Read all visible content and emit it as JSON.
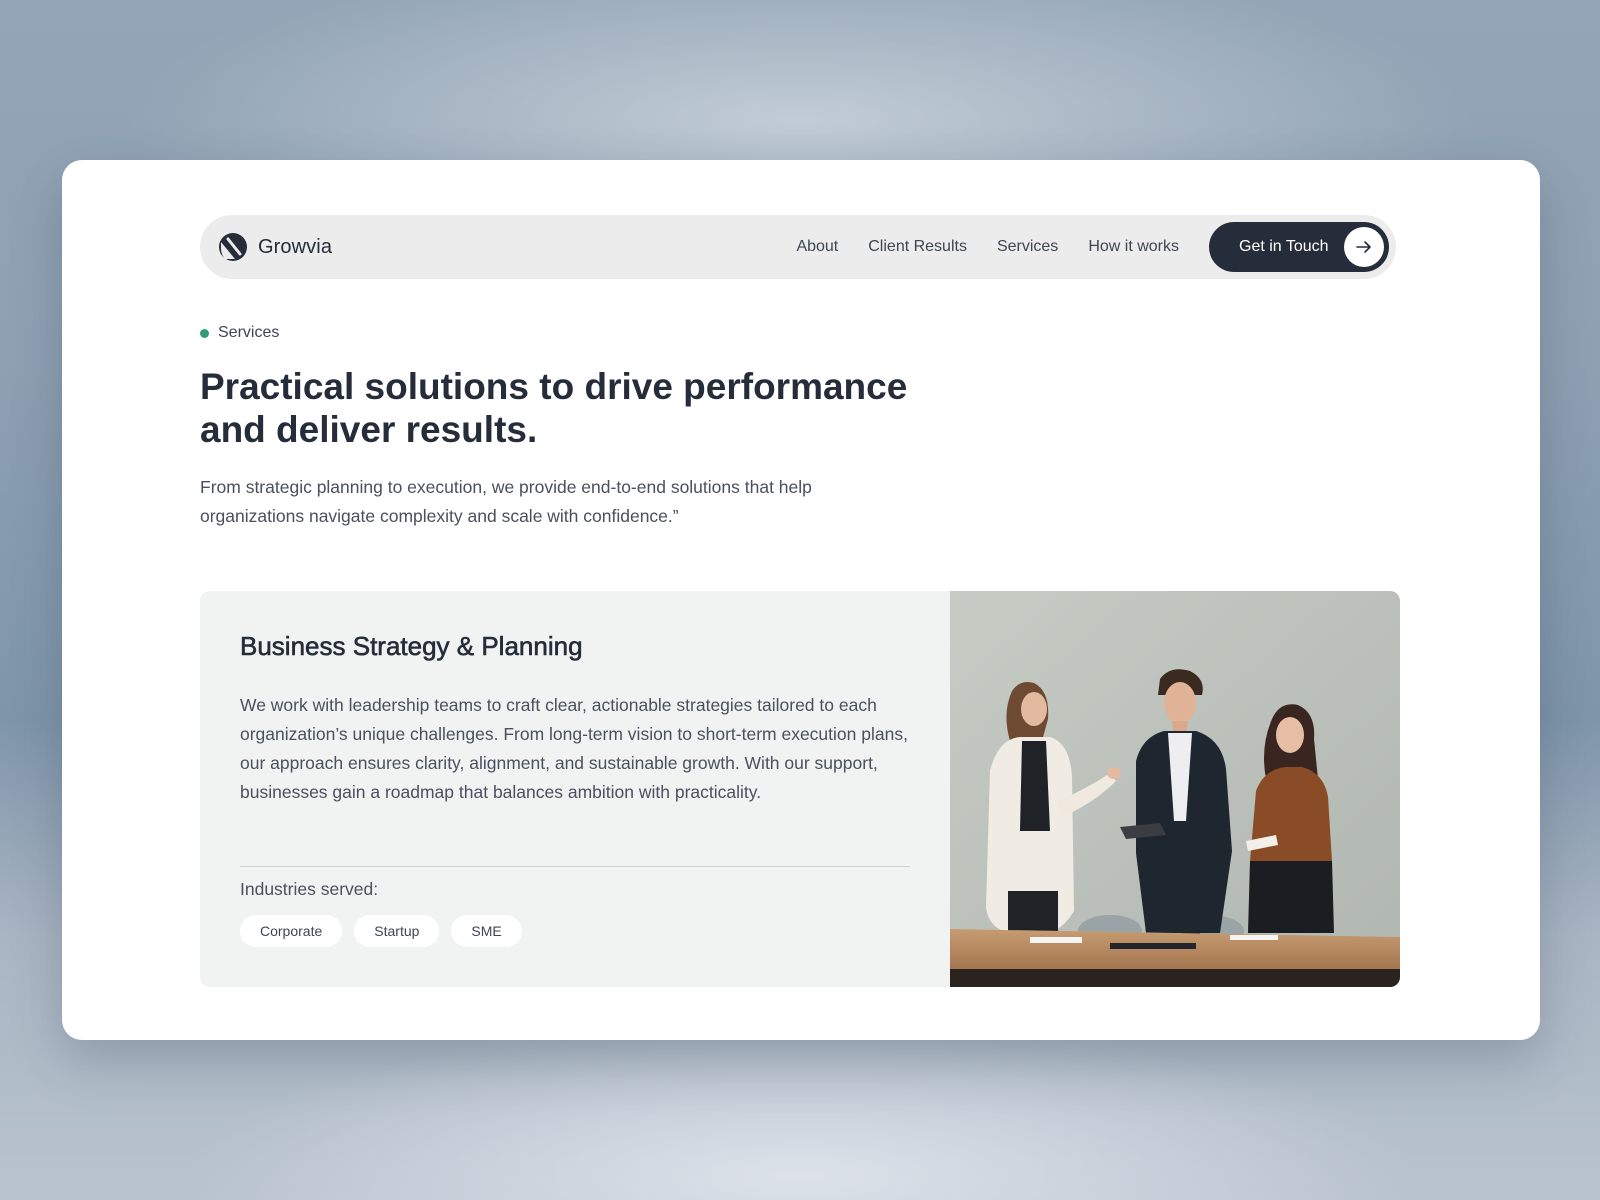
{
  "brand": {
    "name": "Growvia",
    "logo_icon": "growvia-logo-icon"
  },
  "nav": {
    "links": [
      "About",
      "Client Results",
      "Services",
      "How it works"
    ],
    "cta_label": "Get in Touch",
    "cta_icon": "arrow-right-icon"
  },
  "hero": {
    "eyebrow": "Services",
    "headline_line1": "Practical solutions to drive performance",
    "headline_line2": "and deliver results.",
    "subtext_line1": "From strategic planning to execution, we provide end-to-end solutions that help",
    "subtext_line2": "organizations navigate complexity and scale with confidence.”"
  },
  "service": {
    "title": "Business Strategy & Planning",
    "description": "We work with leadership teams to craft clear, actionable strategies tailored to each organization’s unique challenges. From long-term vision to short-term execution plans, our approach ensures clarity, alignment, and sustainable growth. With our support, businesses gain a roadmap that balances ambition with practicality.",
    "industries_label": "Industries served:",
    "industries": [
      "Corporate",
      "Startup",
      "SME"
    ]
  },
  "colors": {
    "accent_dot": "#2f9e76",
    "dark": "#252c3a",
    "nav_bg": "#ececec",
    "card_panel": "#f1f3f2"
  }
}
